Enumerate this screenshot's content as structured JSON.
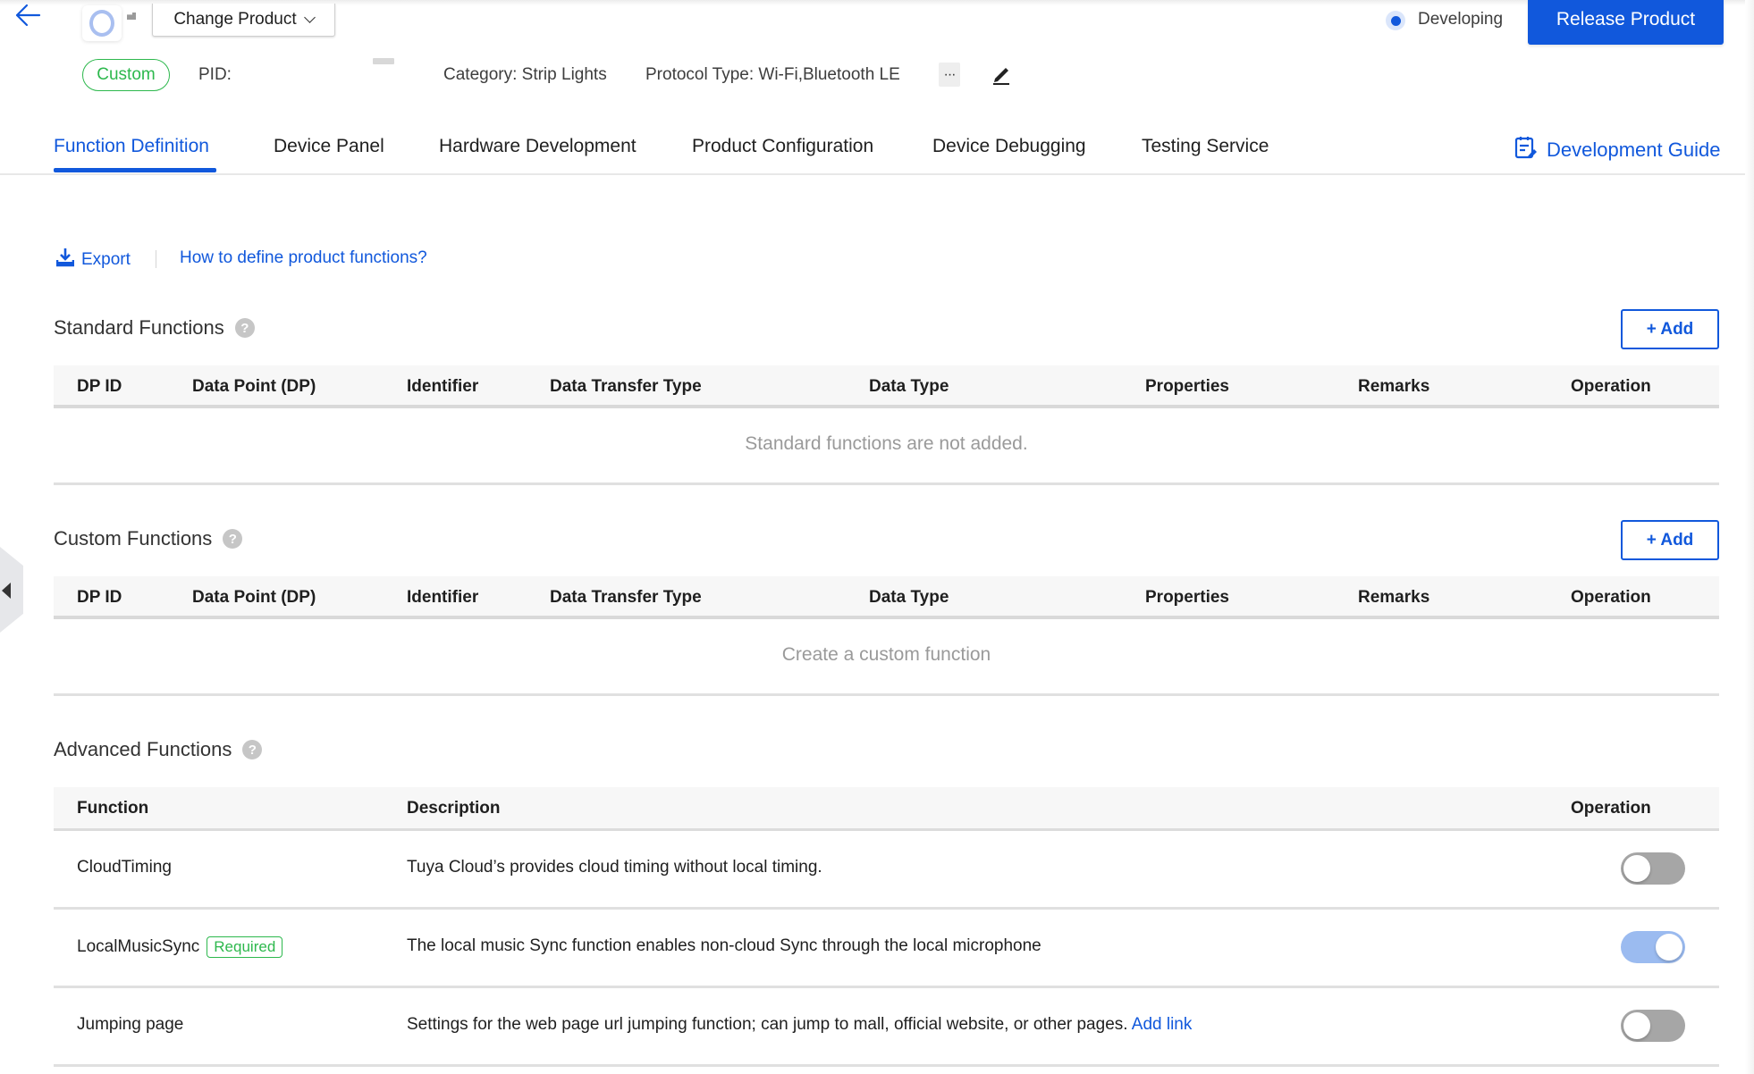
{
  "header": {
    "change_product_label": "Change Product",
    "status": "Developing",
    "release_label": "Release Product",
    "product_type_badge": "Custom",
    "pid_label": "PID:",
    "category": "Category: Strip Lights",
    "protocol": "Protocol Type: Wi-Fi,Bluetooth LE",
    "more_label": "···"
  },
  "colors": {
    "accent": "#1158dc",
    "success": "#2db84d",
    "toggle_on": "#9bbbf0",
    "toggle_off": "#a6a6a6"
  },
  "tabs": [
    {
      "label": "Function Definition",
      "active": true
    },
    {
      "label": "Device Panel",
      "active": false
    },
    {
      "label": "Hardware Development",
      "active": false
    },
    {
      "label": "Product Configuration",
      "active": false
    },
    {
      "label": "Device Debugging",
      "active": false
    },
    {
      "label": "Testing Service",
      "active": false
    }
  ],
  "dev_guide_label": "Development Guide",
  "toolbar": {
    "export_label": "Export",
    "howto_label": "How to define product functions?"
  },
  "standard": {
    "title": "Standard Functions",
    "add_label": "+ Add",
    "columns": [
      "DP ID",
      "Data Point (DP)",
      "Identifier",
      "Data Transfer Type",
      "Data Type",
      "Properties",
      "Remarks",
      "Operation"
    ],
    "empty_text": "Standard functions are not added."
  },
  "custom": {
    "title": "Custom Functions",
    "add_label": "+ Add",
    "columns": [
      "DP ID",
      "Data Point (DP)",
      "Identifier",
      "Data Transfer Type",
      "Data Type",
      "Properties",
      "Remarks",
      "Operation"
    ],
    "empty_text": "Create a custom function"
  },
  "advanced": {
    "title": "Advanced Functions",
    "columns": [
      "Function",
      "Description",
      "Operation"
    ],
    "rows": [
      {
        "function": "CloudTiming",
        "badge": "",
        "description": "Tuya Cloud’s provides cloud timing without local timing.",
        "link": "",
        "enabled": false
      },
      {
        "function": "LocalMusicSync",
        "badge": "Required",
        "description": "The local music Sync function enables non-cloud Sync through the local microphone",
        "link": "",
        "enabled": true
      },
      {
        "function": "Jumping page",
        "badge": "",
        "description": "Settings for the web page url jumping function; can jump to mall, official website, or other pages.",
        "link": "Add link",
        "enabled": false
      }
    ]
  },
  "help_glyph": "?"
}
